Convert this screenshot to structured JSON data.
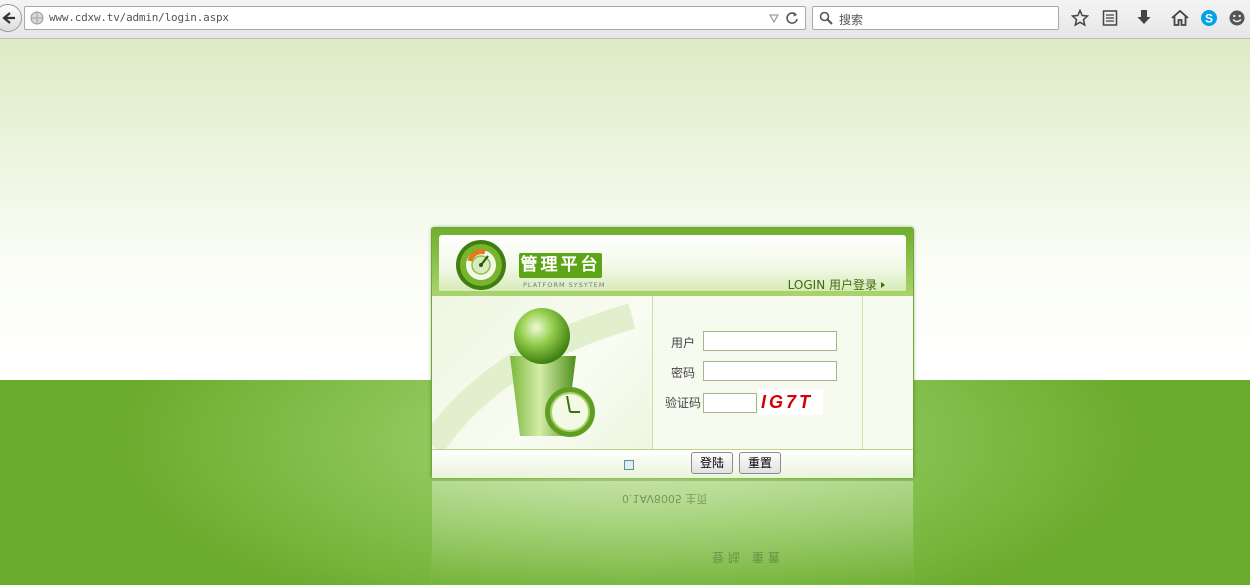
{
  "browser": {
    "url": "www.cdxw.tv/admin/login.aspx",
    "search_placeholder": "搜索"
  },
  "panel": {
    "title": "管理平台",
    "subtitle": "PLATFORM SYSYTEM",
    "login_heading": "LOGIN 用户登录"
  },
  "form": {
    "username_label": "用户",
    "username_value": "",
    "password_label": "密码",
    "password_value": "",
    "captcha_label": "验证码",
    "captcha_value": "",
    "captcha_code": "IG7T"
  },
  "buttons": {
    "login": "登陆",
    "reset": "重置"
  },
  "reflection_text": "0.1AV8005 主页"
}
